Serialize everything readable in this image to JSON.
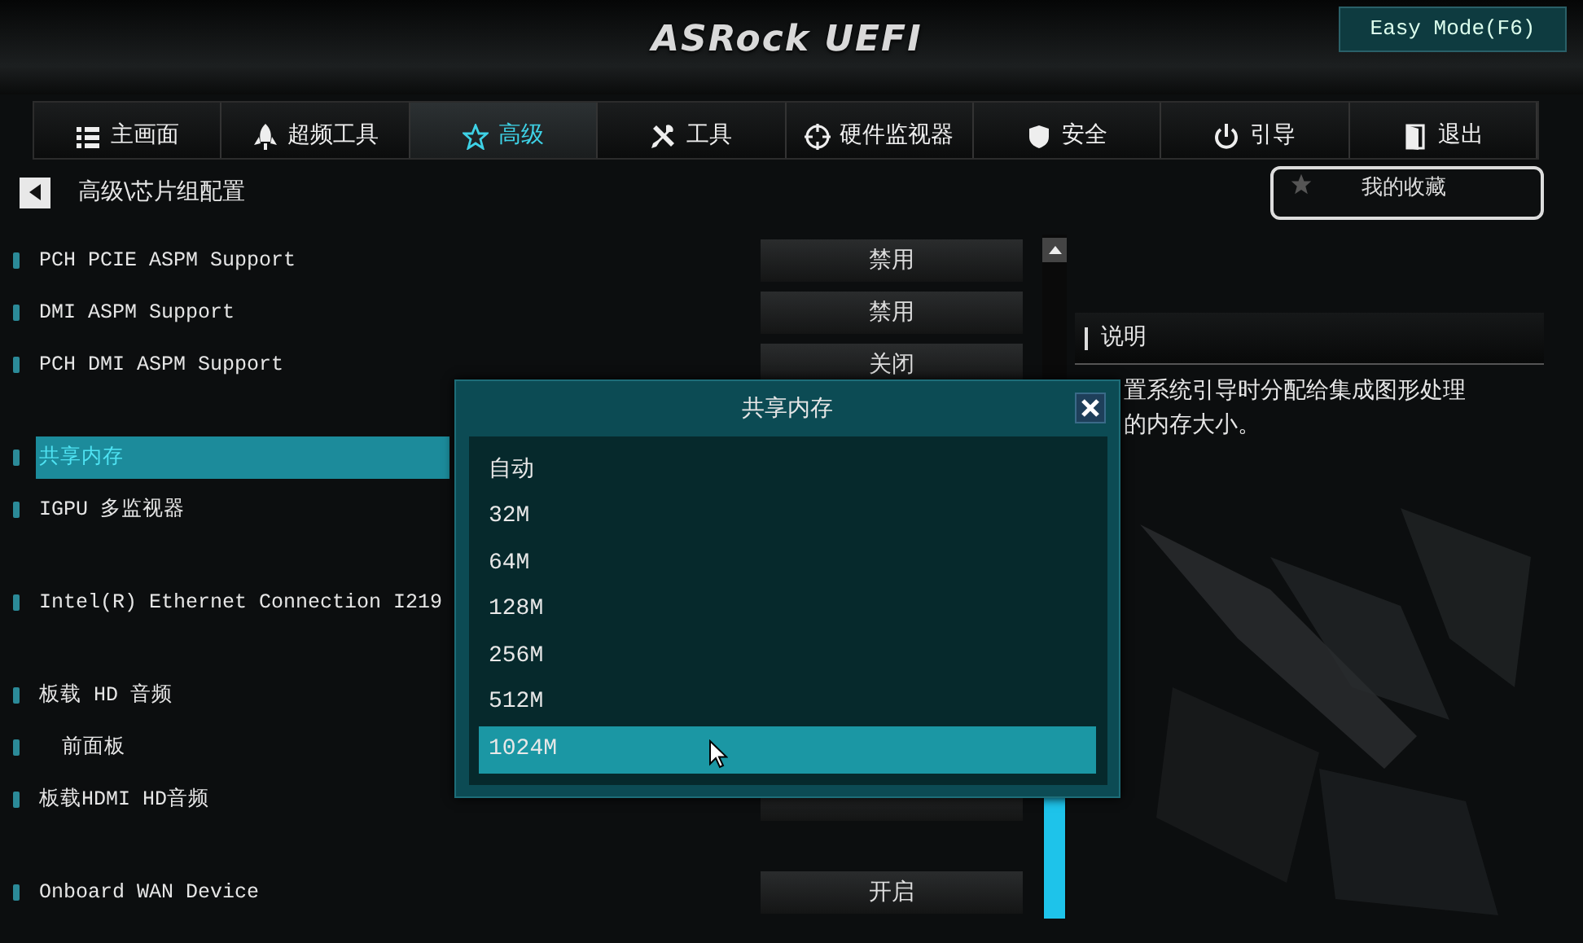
{
  "header": {
    "logo": "ASRock UEFI",
    "mode_button": "Easy Mode(F6)"
  },
  "tabs": [
    {
      "label": "主画面",
      "selected": false
    },
    {
      "label": "超频工具",
      "selected": false
    },
    {
      "label": "高级",
      "selected": true
    },
    {
      "label": "工具",
      "selected": false
    },
    {
      "label": "硬件监视器",
      "selected": false
    },
    {
      "label": "安全",
      "selected": false
    },
    {
      "label": "引导",
      "selected": false
    },
    {
      "label": "退出",
      "selected": false
    }
  ],
  "breadcrumb": "高级\\芯片组配置",
  "favorites_button": "我的收藏",
  "settings_groups": [
    [
      {
        "kind": "select",
        "label": "PCH PCIE ASPM Support",
        "value": "禁用",
        "selected": false
      },
      {
        "kind": "select",
        "label": "DMI ASPM Support",
        "value": "禁用",
        "selected": false
      },
      {
        "kind": "select",
        "label": "PCH DMI ASPM Support",
        "value": "关闭",
        "selected": false
      }
    ],
    [
      {
        "kind": "label",
        "label": "共享内存",
        "selected": true
      },
      {
        "kind": "label",
        "label": "IGPU 多监视器",
        "selected": false
      }
    ],
    [
      {
        "kind": "label",
        "label": "Intel(R) Ethernet Connection I219",
        "selected": false
      }
    ],
    [
      {
        "kind": "label",
        "label": "板载 HD 音频",
        "selected": false,
        "children": [
          {
            "label": "前面板",
            "selected": false
          }
        ]
      },
      {
        "kind": "select",
        "label": "板载HDMI HD音频",
        "selected": false
      }
    ],
    [
      {
        "kind": "select",
        "label": "Onboard WAN Device",
        "value": "开启",
        "selected": false
      }
    ]
  ],
  "description": {
    "title": "说明",
    "lines": [
      "置系统引导时分配给集成图形处理",
      "的内存大小。"
    ]
  },
  "dialog": {
    "title": "共享内存",
    "options": [
      {
        "label": "自动",
        "selected": false
      },
      {
        "label": "32M",
        "selected": false
      },
      {
        "label": "64M",
        "selected": false
      },
      {
        "label": "128M",
        "selected": false
      },
      {
        "label": "256M",
        "selected": false
      },
      {
        "label": "512M",
        "selected": false
      },
      {
        "label": "1024M",
        "selected": true
      }
    ]
  }
}
